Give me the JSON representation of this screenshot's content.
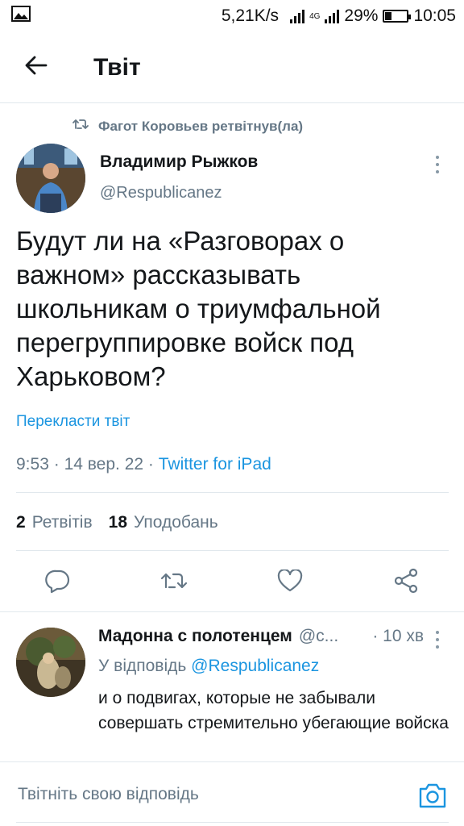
{
  "status_bar": {
    "speed": "5,21K/s",
    "network": "4G",
    "battery": "29%",
    "time": "10:05",
    "icons": [
      "image-icon",
      "signal-icon",
      "battery-icon"
    ]
  },
  "header": {
    "title": "Твіт",
    "back_icon": "arrow-left-icon"
  },
  "retweet": {
    "text": "Фагот Коровьев ретвітнув(ла)",
    "icon": "retweet-icon"
  },
  "tweet": {
    "author_name": "Владимир Рыжков",
    "author_handle": "@Respublicanez",
    "text": "Будут ли на «Разговорах о важном» рассказывать школьникам о триумфальной перегруппировке войск под Харьковом?",
    "translate_label": "Перекласти твіт",
    "time": "9:53",
    "date": "14 вер. 22",
    "separator": "·",
    "source": "Twitter for iPad",
    "retweets_count": "2",
    "retweets_label": "Ретвітів",
    "likes_count": "18",
    "likes_label": "Уподобань"
  },
  "actions": [
    {
      "name": "reply",
      "icon": "comment-icon"
    },
    {
      "name": "retweet",
      "icon": "retweet-icon"
    },
    {
      "name": "like",
      "icon": "heart-icon"
    },
    {
      "name": "share",
      "icon": "share-icon"
    }
  ],
  "reply": {
    "author_name": "Мадонна с полотенцем",
    "author_handle": "@c...",
    "time": "· 10 хв",
    "reply_to_prefix": "У відповідь",
    "reply_to_handle": "@Respublicanez",
    "text": "и о подвигах, которые не забывали совершать стремительно убегающие войска"
  },
  "compose": {
    "placeholder": "Твітніть свою відповідь",
    "camera_icon": "camera-icon"
  },
  "colors": {
    "accent": "#1b95e0",
    "secondary_text": "#657786",
    "primary_text": "#14171a",
    "divider": "#e1e8ed"
  }
}
